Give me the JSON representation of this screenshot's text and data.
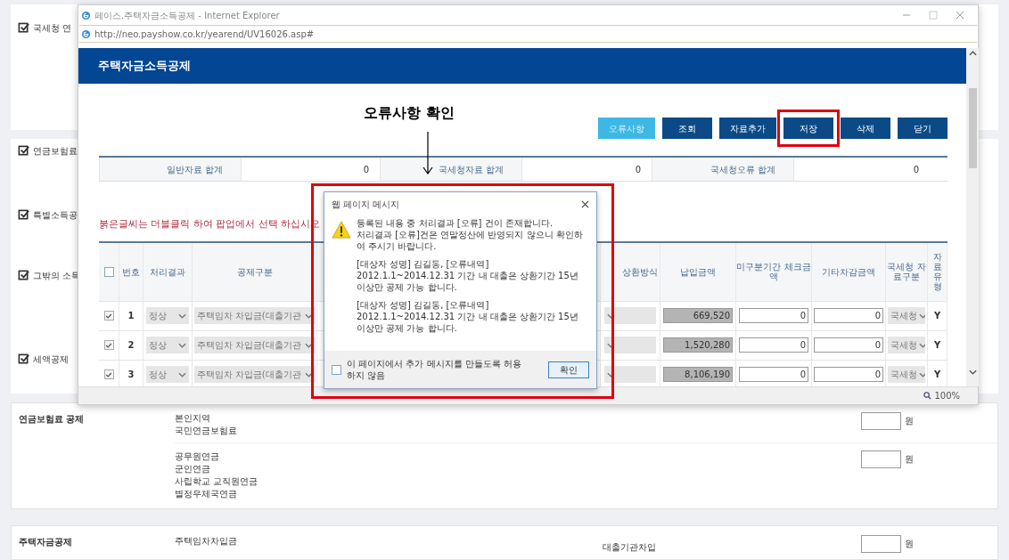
{
  "background": {
    "sections": [
      {
        "label": "국세청 연"
      },
      {
        "label": "연금보험료"
      },
      {
        "label": "특별소득공"
      },
      {
        "label": "그밖의 소득"
      },
      {
        "label": "세액공제"
      }
    ],
    "form": [
      {
        "title": "연금보험료 공제",
        "groups": [
          {
            "lines": [
              "본인지역",
              "국민연금보험료"
            ],
            "unit": "원"
          },
          {
            "lines": [
              "공무원연금",
              "군인연금",
              "사립학교 교직원연금",
              "별정우체국연금"
            ],
            "unit": "원"
          }
        ]
      },
      {
        "title": "주택자금공제",
        "groups": [
          {
            "lines": [
              "주택임차차입금"
            ],
            "middle": "대출기관차입",
            "unit": "원"
          }
        ]
      }
    ]
  },
  "popup_window": {
    "title": "페이스.주택자금소득공제 - Internet Explorer",
    "address": "http://neo.payshow.co.kr/yearend/UV16026.asp#",
    "header": "주택자금소득공제",
    "annotation": "오류사항 확인",
    "buttons": [
      {
        "label": "오류사항",
        "kind": "accent",
        "highlighted": false
      },
      {
        "label": "조회",
        "kind": "normal",
        "highlighted": false
      },
      {
        "label": "자료추가",
        "kind": "normal",
        "highlighted": false
      },
      {
        "label": "저장",
        "kind": "normal",
        "highlighted": true
      },
      {
        "label": "삭제",
        "kind": "normal",
        "highlighted": false
      },
      {
        "label": "닫기",
        "kind": "normal",
        "highlighted": false
      }
    ],
    "summary": [
      {
        "label": "일반자료 합계",
        "value": "0"
      },
      {
        "label": "국세청자료 합계",
        "value": "0"
      },
      {
        "label": "국세청오류 합계",
        "value": "0"
      }
    ],
    "notice": "붉은글씨는 더블클릭 하여 팝업에서 선택 하십시오",
    "table": {
      "columns": [
        "번호",
        "처리결과",
        "공제구분",
        "상환방식",
        "납입금액",
        "미구분기간 체크금액",
        "기타차감금액",
        "국세청 자료구분",
        "자료유형"
      ],
      "header_checked": false,
      "rows": [
        {
          "checked": true,
          "number": "1",
          "result": "정상",
          "type": "주택임차 차입금(대출기관",
          "amount": "669,520",
          "period_amount": "0",
          "other_amount": "0",
          "source": "국세청",
          "flag": "Y"
        },
        {
          "checked": true,
          "number": "2",
          "result": "정상",
          "type": "주택임차 차입금(대출기관",
          "amount": "1,520,280",
          "period_amount": "0",
          "other_amount": "0",
          "source": "국세청",
          "flag": "Y"
        },
        {
          "checked": true,
          "number": "3",
          "result": "정상",
          "type": "주택임차 차입금(대출기관",
          "amount": "8,106,190",
          "period_amount": "0",
          "other_amount": "0",
          "source": "국세청",
          "flag": "Y"
        }
      ]
    },
    "zoom": "100%"
  },
  "dialog": {
    "title": "웹 페이지 메시지",
    "paragraphs": [
      "등록된 내용 중 처리결과 [오류] 건이 존재합니다.\n처리결과 [오류]건은 연말정산에 반영되지 않으니 확인하여 주시기 바랍니다.",
      "[대상자 성명] 김길동, [오류내역] 2012.1.1~2014.12.31 기간 내 대출은 상환기간 15년 이상만 공제 가능 합니다.",
      "[대상자 성명] 김길동, [오류내역] 2012.1.1~2014.12.31 기간 내 대출은 상환기간 15년 이상만 공제 가능 합니다."
    ],
    "suppress_label": "이 페이지에서 추가 메시지를 만들도록 허용하지 않음",
    "suppress_checked": false,
    "ok": "확인"
  }
}
